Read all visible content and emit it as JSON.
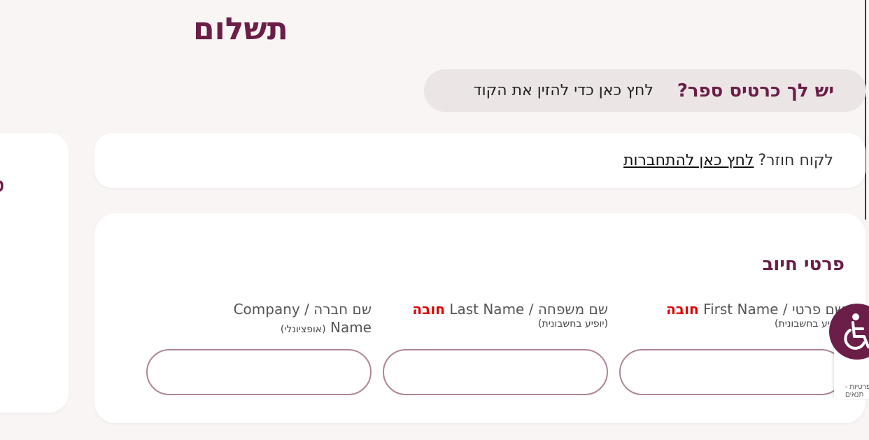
{
  "page": {
    "title": "תשלום"
  },
  "voucher": {
    "question": "יש לך כרטיס ספר?",
    "link": "לחץ כאן כדי להזין את הקוד"
  },
  "side_summary": {
    "heading_fragment": "ס"
  },
  "returning_customer": {
    "question": "לקוח חוזר?",
    "link": "לחץ כאן להתחברות"
  },
  "billing": {
    "title": "פרטי חיוב",
    "fields": [
      {
        "label": "שם פרטי / First Name",
        "required": "חובה",
        "note": "(יופיע בחשבונית)",
        "value": ""
      },
      {
        "label": "שם משפחה / Last Name",
        "required": "חובה",
        "note": "(יופיע בחשבונית)",
        "value": ""
      },
      {
        "label": "שם חברה / Company Name",
        "required": "",
        "note": "(אופציונלי)",
        "value": ""
      }
    ]
  },
  "widgets": {
    "accessibility_icon": "wheelchair-icon",
    "recaptcha_text": "פרטיות - תנאים"
  },
  "colors": {
    "brand": "#6b1e47",
    "required": "#e00000",
    "input_border": "#b08496",
    "background": "#f8f5f4"
  }
}
